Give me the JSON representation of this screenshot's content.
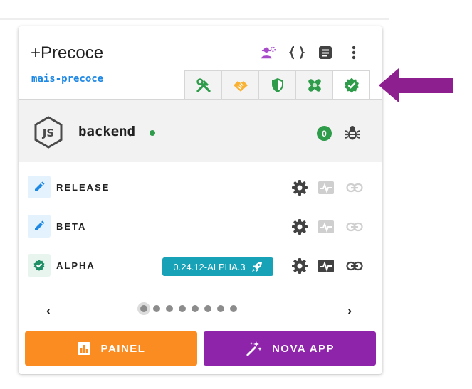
{
  "header": {
    "title": "+Precoce",
    "subtitle": "mais-precoce",
    "icons": [
      "users-gear-icon",
      "code-braces-icon",
      "document-icon",
      "more-vert-icon"
    ]
  },
  "tabs": [
    {
      "name": "tools",
      "color": "#2e9c4a"
    },
    {
      "name": "handshake",
      "color": "#f9b233"
    },
    {
      "name": "shield",
      "color": "#2e9c4a"
    },
    {
      "name": "bandage",
      "color": "#2e9c4a"
    },
    {
      "name": "verified",
      "color": "#2e9c4a"
    }
  ],
  "app": {
    "name": "backend",
    "status_color": "#2e9c4a",
    "issue_count": "0"
  },
  "environments": [
    {
      "label": "RELEASE",
      "status": "pencil-icon",
      "version": null
    },
    {
      "label": "BETA",
      "status": "pencil-icon",
      "version": null
    },
    {
      "label": "ALPHA",
      "status": "verified-icon",
      "version": "0.24.12-ALPHA.3"
    }
  ],
  "pager": {
    "total_pages": 8,
    "current_page": 1
  },
  "actions": {
    "painel_label": "PAINEL",
    "nova_app_label": "NOVA APP",
    "painel_color": "#fb8c22",
    "nova_app_color": "#8e24aa"
  },
  "colors": {
    "accent_blue": "#1e88e5",
    "success": "#2e9c4a",
    "chip": "#17a2b8",
    "arrow": "#8e1f8e"
  }
}
